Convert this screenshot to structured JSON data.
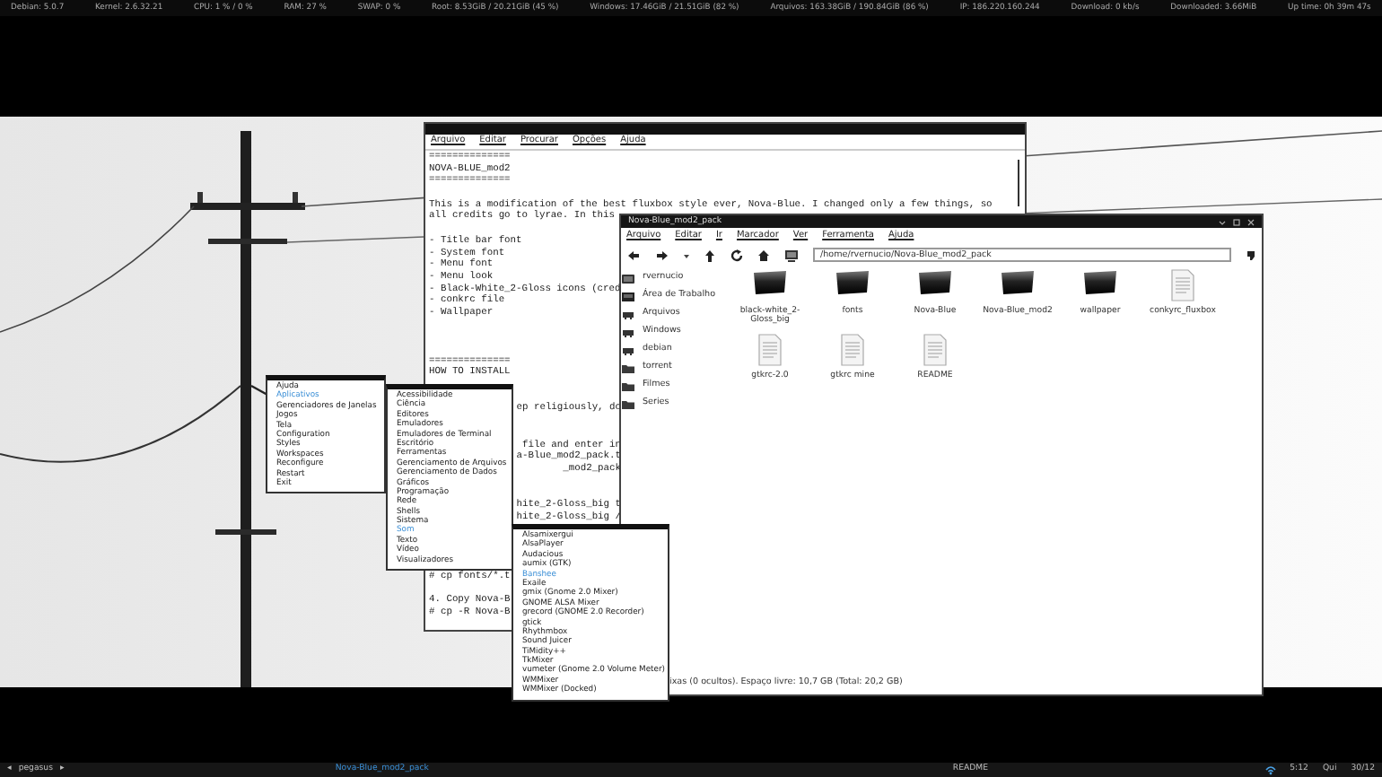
{
  "top_bar": {
    "stats": [
      "Debian: 5.0.7",
      "Kernel: 2.6.32.21",
      "CPU: 1 % / 0 %",
      "RAM: 27 %",
      "SWAP: 0 %",
      "Root: 8.53GiB / 20.21GiB  (45 %)",
      "Windows: 17.46GiB / 21.51GiB  (82 %)",
      "Arquivos: 163.38GiB / 190.84GiB  (86 %)",
      "IP: 186.220.160.244",
      "Download: 0   kb/s",
      "Downloaded: 3.66MiB",
      "Up time: 0h 39m 47s"
    ]
  },
  "editor": {
    "menu": [
      "Arquivo",
      "Editar",
      "Procurar",
      "Opções",
      "Ajuda"
    ],
    "lines": [
      {
        "kind": "text",
        "text": "=============="
      },
      {
        "kind": "text",
        "text": "NOVA-BLUE_mod2"
      },
      {
        "kind": "text",
        "text": "=============="
      },
      {
        "kind": "blank"
      },
      {
        "kind": "text",
        "text": "This is a modification of the best fluxbox style ever, Nova-Blue. I changed only a few things, so"
      },
      {
        "kind": "text",
        "text": "all credits go to lyrae. In this"
      },
      {
        "kind": "blank"
      },
      {
        "kind": "text",
        "text": "- Title bar font"
      },
      {
        "kind": "text",
        "text": "- System font"
      },
      {
        "kind": "text",
        "text": "- Menu font"
      },
      {
        "kind": "text",
        "text": "- Menu look"
      },
      {
        "kind": "text",
        "text": "- Black-White_2-Gloss icons (cred"
      },
      {
        "kind": "text",
        "text": "- conkrc file"
      },
      {
        "kind": "text",
        "text": "- Wallpaper"
      },
      {
        "kind": "blank"
      },
      {
        "kind": "blank"
      },
      {
        "kind": "blank"
      },
      {
        "kind": "text",
        "text": "=============="
      },
      {
        "kind": "text",
        "text": "HOW TO INSTALL"
      },
      {
        "kind": "blank"
      },
      {
        "kind": "blank"
      },
      {
        "kind": "fragment",
        "text": "ep religiously, do"
      },
      {
        "kind": "blank"
      },
      {
        "kind": "blank"
      },
      {
        "kind": "fragment",
        "text": "file and enter in"
      },
      {
        "kind": "fragment",
        "text": "a-Blue_mod2_pack.t"
      },
      {
        "kind": "fragment",
        "text": "_mod2_pack"
      },
      {
        "kind": "blank"
      },
      {
        "kind": "blank"
      },
      {
        "kind": "fragment",
        "text": "hite_2-Gloss_big t"
      },
      {
        "kind": "fragment",
        "text": "hite_2-Gloss_big /"
      },
      {
        "kind": "blank"
      },
      {
        "kind": "blank"
      },
      {
        "kind": "blank"
      },
      {
        "kind": "blank"
      },
      {
        "kind": "text",
        "text": "# cp fonts/*.t"
      },
      {
        "kind": "blank"
      },
      {
        "kind": "text",
        "text": "4. Copy Nova-B"
      },
      {
        "kind": "text",
        "text": "# cp -R Nova-B"
      }
    ]
  },
  "file_manager": {
    "title": "Nova-Blue_mod2_pack",
    "menu": [
      "Arquivo",
      "Editar",
      "Ir",
      "Marcador",
      "Ver",
      "Ferramenta",
      "Ajuda"
    ],
    "path": "/home/rvernucio/Nova-Blue_mod2_pack",
    "places": [
      {
        "label": "rvernucio",
        "kind": "home"
      },
      {
        "label": "Área de Trabalho",
        "kind": "desktop"
      },
      {
        "label": "Arquivos",
        "kind": "drive"
      },
      {
        "label": "Windows",
        "kind": "drive"
      },
      {
        "label": "debian",
        "kind": "drive"
      },
      {
        "label": "torrent",
        "kind": "folder"
      },
      {
        "label": "Filmes",
        "kind": "folder"
      },
      {
        "label": "Series",
        "kind": "folder"
      }
    ],
    "items": [
      {
        "name": "black-white_2-Gloss_big",
        "kind": "folder"
      },
      {
        "name": "fonts",
        "kind": "folder"
      },
      {
        "name": "Nova-Blue",
        "kind": "folder"
      },
      {
        "name": "Nova-Blue_mod2",
        "kind": "folder"
      },
      {
        "name": "wallpaper",
        "kind": "folder"
      },
      {
        "name": "conkyrc_fluxbox",
        "kind": "file"
      },
      {
        "name": "gtkrc-2.0",
        "kind": "file"
      },
      {
        "name": "gtkrc mine",
        "kind": "file"
      },
      {
        "name": "README",
        "kind": "file"
      }
    ],
    "status": "ixas (0 ocultos). Espaço livre: 10,7 GB (Total: 20,2 GB)"
  },
  "menus": [
    {
      "items": [
        {
          "label": "Ajuda",
          "selected": false
        },
        {
          "label": "Aplicativos",
          "selected": true
        },
        {
          "label": "Gerenciadores de Janelas",
          "selected": false
        },
        {
          "label": "Jogos",
          "selected": false
        },
        {
          "label": "Tela",
          "selected": false
        },
        {
          "label": "Configuration",
          "selected": false
        },
        {
          "label": "Styles",
          "selected": false
        },
        {
          "label": "Workspaces",
          "selected": false
        },
        {
          "label": "Reconfigure",
          "selected": false
        },
        {
          "label": "Restart",
          "selected": false
        },
        {
          "label": "Exit",
          "selected": false
        }
      ]
    },
    {
      "items": [
        {
          "label": "Acessibilidade",
          "selected": false
        },
        {
          "label": "Ciência",
          "selected": false
        },
        {
          "label": "Editores",
          "selected": false
        },
        {
          "label": "Emuladores",
          "selected": false
        },
        {
          "label": "Emuladores de Terminal",
          "selected": false
        },
        {
          "label": "Escritório",
          "selected": false
        },
        {
          "label": "Ferramentas",
          "selected": false
        },
        {
          "label": "Gerenciamento de Arquivos",
          "selected": false
        },
        {
          "label": "Gerenciamento de Dados",
          "selected": false
        },
        {
          "label": "Gráficos",
          "selected": false
        },
        {
          "label": "Programação",
          "selected": false
        },
        {
          "label": "Rede",
          "selected": false
        },
        {
          "label": "Shells",
          "selected": false
        },
        {
          "label": "Sistema",
          "selected": false
        },
        {
          "label": "Som",
          "selected": true
        },
        {
          "label": "Texto",
          "selected": false
        },
        {
          "label": "Vídeo",
          "selected": false
        },
        {
          "label": "Visualizadores",
          "selected": false
        }
      ]
    },
    {
      "items": [
        {
          "label": "Alsamixergui",
          "selected": false
        },
        {
          "label": "AlsaPlayer",
          "selected": false
        },
        {
          "label": "Audacious",
          "selected": false
        },
        {
          "label": "aumix (GTK)",
          "selected": false
        },
        {
          "label": "Banshee",
          "selected": true
        },
        {
          "label": "Exaile",
          "selected": false
        },
        {
          "label": "gmix (Gnome 2.0 Mixer)",
          "selected": false
        },
        {
          "label": "GNOME ALSA Mixer",
          "selected": false
        },
        {
          "label": "grecord (GNOME 2.0 Recorder)",
          "selected": false
        },
        {
          "label": "gtick",
          "selected": false
        },
        {
          "label": "Rhythmbox",
          "selected": false
        },
        {
          "label": "Sound Juicer",
          "selected": false
        },
        {
          "label": "TiMidity++",
          "selected": false
        },
        {
          "label": "TkMixer",
          "selected": false
        },
        {
          "label": "vumeter (Gnome 2.0 Volume Meter)",
          "selected": false
        },
        {
          "label": "WMMixer",
          "selected": false
        },
        {
          "label": "WMMixer (Docked)",
          "selected": false
        }
      ]
    }
  ],
  "taskbar": {
    "prev": "◂",
    "workspace": "pegasus",
    "next": "▸",
    "tasks": [
      {
        "label": "Nova-Blue_mod2_pack",
        "selected": true
      },
      {
        "label": "README",
        "selected": false
      }
    ],
    "time": "5:12",
    "day": "Qui",
    "date": "30/12"
  }
}
